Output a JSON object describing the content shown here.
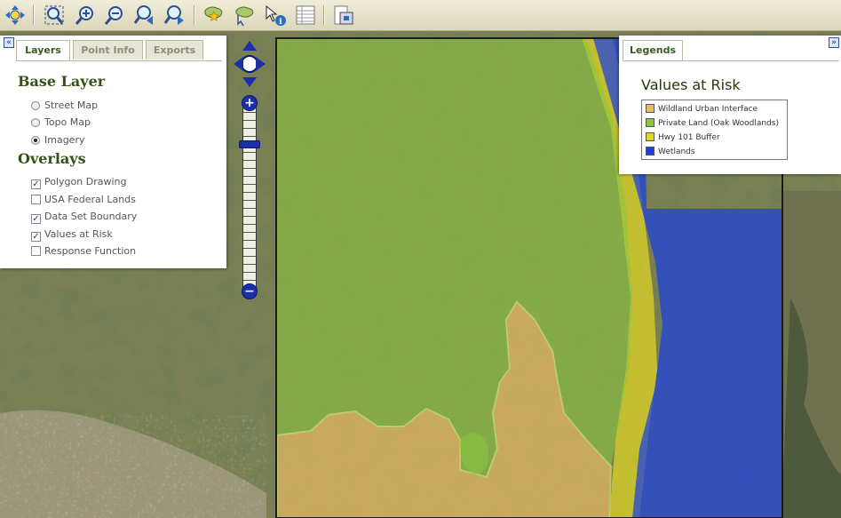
{
  "toolbar": {
    "tools": [
      "pan-icon",
      "zoom-extent-icon",
      "zoom-in-icon",
      "zoom-out-icon",
      "zoom-previous-icon",
      "zoom-next-icon",
      "add-polygon-icon",
      "select-polygon-icon",
      "identify-icon",
      "attribute-table-icon",
      "print-icon"
    ]
  },
  "layers_panel": {
    "collapse_glyph": "«",
    "tabs": [
      "Layers",
      "Point Info",
      "Exports"
    ],
    "base_layer_heading": "Base Layer",
    "base_layers": [
      {
        "label": "Street Map",
        "selected": false
      },
      {
        "label": "Topo Map",
        "selected": false
      },
      {
        "label": "Imagery",
        "selected": true
      }
    ],
    "overlays_heading": "Overlays",
    "overlays": [
      {
        "label": "Polygon Drawing",
        "checked": true
      },
      {
        "label": "USA Federal Lands",
        "checked": false
      },
      {
        "label": "Data Set Boundary",
        "checked": true
      },
      {
        "label": "Values at Risk",
        "checked": true
      },
      {
        "label": "Response Function",
        "checked": false
      }
    ]
  },
  "zoom": {
    "plus": "+",
    "minus": "−"
  },
  "legends_panel": {
    "tab": "Legends",
    "collapse_glyph": "»",
    "title": "Values at Risk",
    "items": [
      {
        "label": "Wildland Urban Interface",
        "color": "#e9bb62"
      },
      {
        "label": "Private Land (Oak Woodlands)",
        "color": "#8cc63f"
      },
      {
        "label": "Hwy 101 Buffer",
        "color": "#e1d622"
      },
      {
        "label": "Wetlands",
        "color": "#1a3ee0"
      }
    ]
  },
  "colors": {
    "wui": "#e9bb62",
    "oak": "#8cc63f",
    "hwy": "#e1d622",
    "wetlands": "#1a3ee0"
  }
}
